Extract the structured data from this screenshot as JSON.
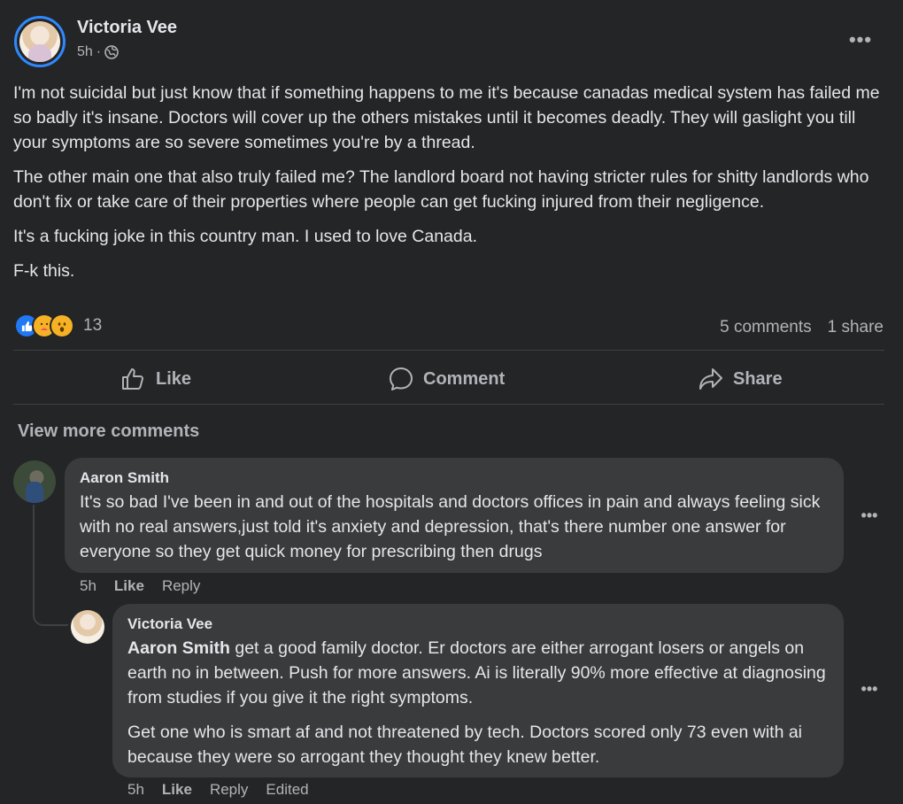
{
  "post": {
    "author": "Victoria Vee",
    "time": "5h",
    "separator": "·",
    "paragraphs": [
      "I'm not suicidal but just know that if something happens to me it's because canadas medical system has failed me so badly it's insane. Doctors will cover up the others mistakes until it becomes deadly. They will gaslight you till your symptoms are so severe sometimes you're by a thread.",
      "The other main one that also truly failed me? The landlord board not having stricter rules for shitty landlords who don't fix or take care of their properties where people can get fucking injured from their negligence.",
      "It's a fucking joke in this country man. I used to love Canada.",
      "F-k this."
    ],
    "reaction_count": "13",
    "comments_count": "5 comments",
    "shares_count": "1 share"
  },
  "actions": {
    "like": "Like",
    "comment": "Comment",
    "share": "Share"
  },
  "view_more": "View more comments",
  "comments": [
    {
      "author": "Aaron Smith",
      "text": "It's so bad I've been in and out of the hospitals and doctors offices in pain and always feeling sick with no real answers,just told it's anxiety and depression, that's there number one answer for everyone so they get quick money for prescribing then drugs",
      "time": "5h",
      "like": "Like",
      "reply": "Reply"
    },
    {
      "author": "Victoria Vee",
      "mention": "Aaron Smith",
      "text1": " get a good family doctor. Er doctors are either arrogant losers or angels on earth no in between. Push for more answers. Ai is literally 90% more effective at diagnosing from studies if you give it the right symptoms.",
      "text2": "Get one who is smart af and not threatened by tech. Doctors scored only 73 even with ai because they were so arrogant they thought they knew better.",
      "time": "5h",
      "like": "Like",
      "reply": "Reply",
      "edited": "Edited"
    }
  ],
  "colors": {
    "background": "#242526",
    "bubble": "#3a3b3c",
    "text_primary": "#e4e6eb",
    "text_secondary": "#b0b3b8",
    "accent": "#2e89ff"
  }
}
